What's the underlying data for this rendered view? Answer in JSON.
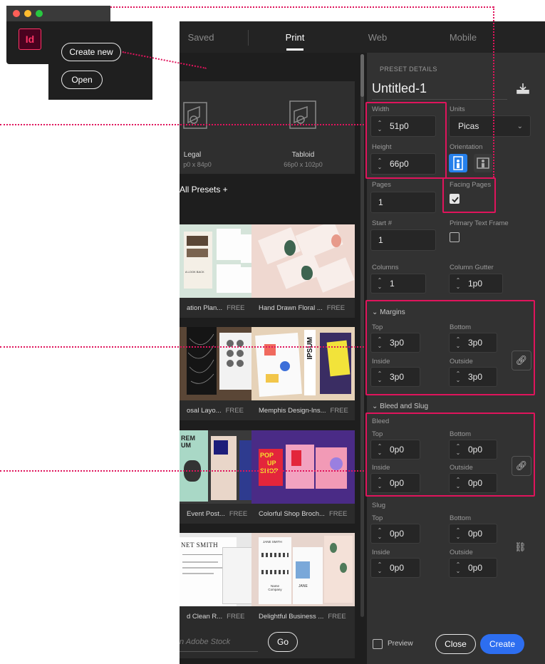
{
  "mini_app": {
    "logo": "Id",
    "create_new": "Create new",
    "open": "Open"
  },
  "tabs": [
    {
      "label": "Saved"
    },
    {
      "label": "Print"
    },
    {
      "label": "Web"
    },
    {
      "label": "Mobile"
    }
  ],
  "blank_presets": [
    {
      "name": "Legal",
      "size": "p0 x 84p0"
    },
    {
      "name": "Tabloid",
      "size": "66p0 x 102p0"
    }
  ],
  "view_all": "All Presets +",
  "templates": [
    {
      "name": "ation Plan...",
      "badge": "FREE"
    },
    {
      "name": "Hand Drawn Floral ...",
      "badge": "FREE"
    },
    {
      "name": "osal Layo...",
      "badge": "FREE"
    },
    {
      "name": "Memphis Design-Ins...",
      "badge": "FREE"
    },
    {
      "name": "Event Post...",
      "badge": "FREE"
    },
    {
      "name": "Colorful Shop Broch...",
      "badge": "FREE"
    },
    {
      "name": "d Clean R...",
      "badge": "FREE"
    },
    {
      "name": "Delightful Business ...",
      "badge": "FREE"
    }
  ],
  "template_art": {
    "shop": [
      "POP",
      "UP",
      "SHOP"
    ],
    "ipsum": "IPSUM",
    "rem": "REM",
    "um": "UM",
    "net_smith": "NET SMITH",
    "jane_smith": "JANE SMITH",
    "jane": "JANE",
    "name_company": "Name Company",
    "a_look_back": "A LOOK BACK"
  },
  "search": {
    "placeholder": "n Adobe Stock",
    "go": "Go"
  },
  "preset_details": {
    "heading": "PRESET DETAILS",
    "name": "Untitled-1",
    "width_label": "Width",
    "width": "51p0",
    "height_label": "Height",
    "height": "66p0",
    "units_label": "Units",
    "units": "Picas",
    "orientation_label": "Orientation",
    "pages_label": "Pages",
    "pages": "1",
    "facing_label": "Facing Pages",
    "start_label": "Start #",
    "start": "1",
    "primary_label": "Primary Text Frame",
    "columns_label": "Columns",
    "columns": "1",
    "gutter_label": "Column Gutter",
    "gutter": "1p0"
  },
  "margins": {
    "heading": "Margins",
    "top_label": "Top",
    "top": "3p0",
    "bottom_label": "Bottom",
    "bottom": "3p0",
    "inside_label": "Inside",
    "inside": "3p0",
    "outside_label": "Outside",
    "outside": "3p0"
  },
  "bleed_slug": {
    "heading": "Bleed and Slug",
    "bleed_label": "Bleed",
    "slug_label": "Slug",
    "top_label": "Top",
    "bottom_label": "Bottom",
    "inside_label": "Inside",
    "outside_label": "Outside",
    "bleed_top": "0p0",
    "bleed_bottom": "0p0",
    "bleed_inside": "0p0",
    "bleed_outside": "0p0",
    "slug_top": "0p0",
    "slug_bottom": "0p0",
    "slug_inside": "0p0",
    "slug_outside": "0p0"
  },
  "footer": {
    "preview": "Preview",
    "close": "Close",
    "create": "Create"
  },
  "colors": {
    "highlight": "#e0145c",
    "create_button": "#2d6ef0",
    "accent_blue": "#2680eb"
  }
}
